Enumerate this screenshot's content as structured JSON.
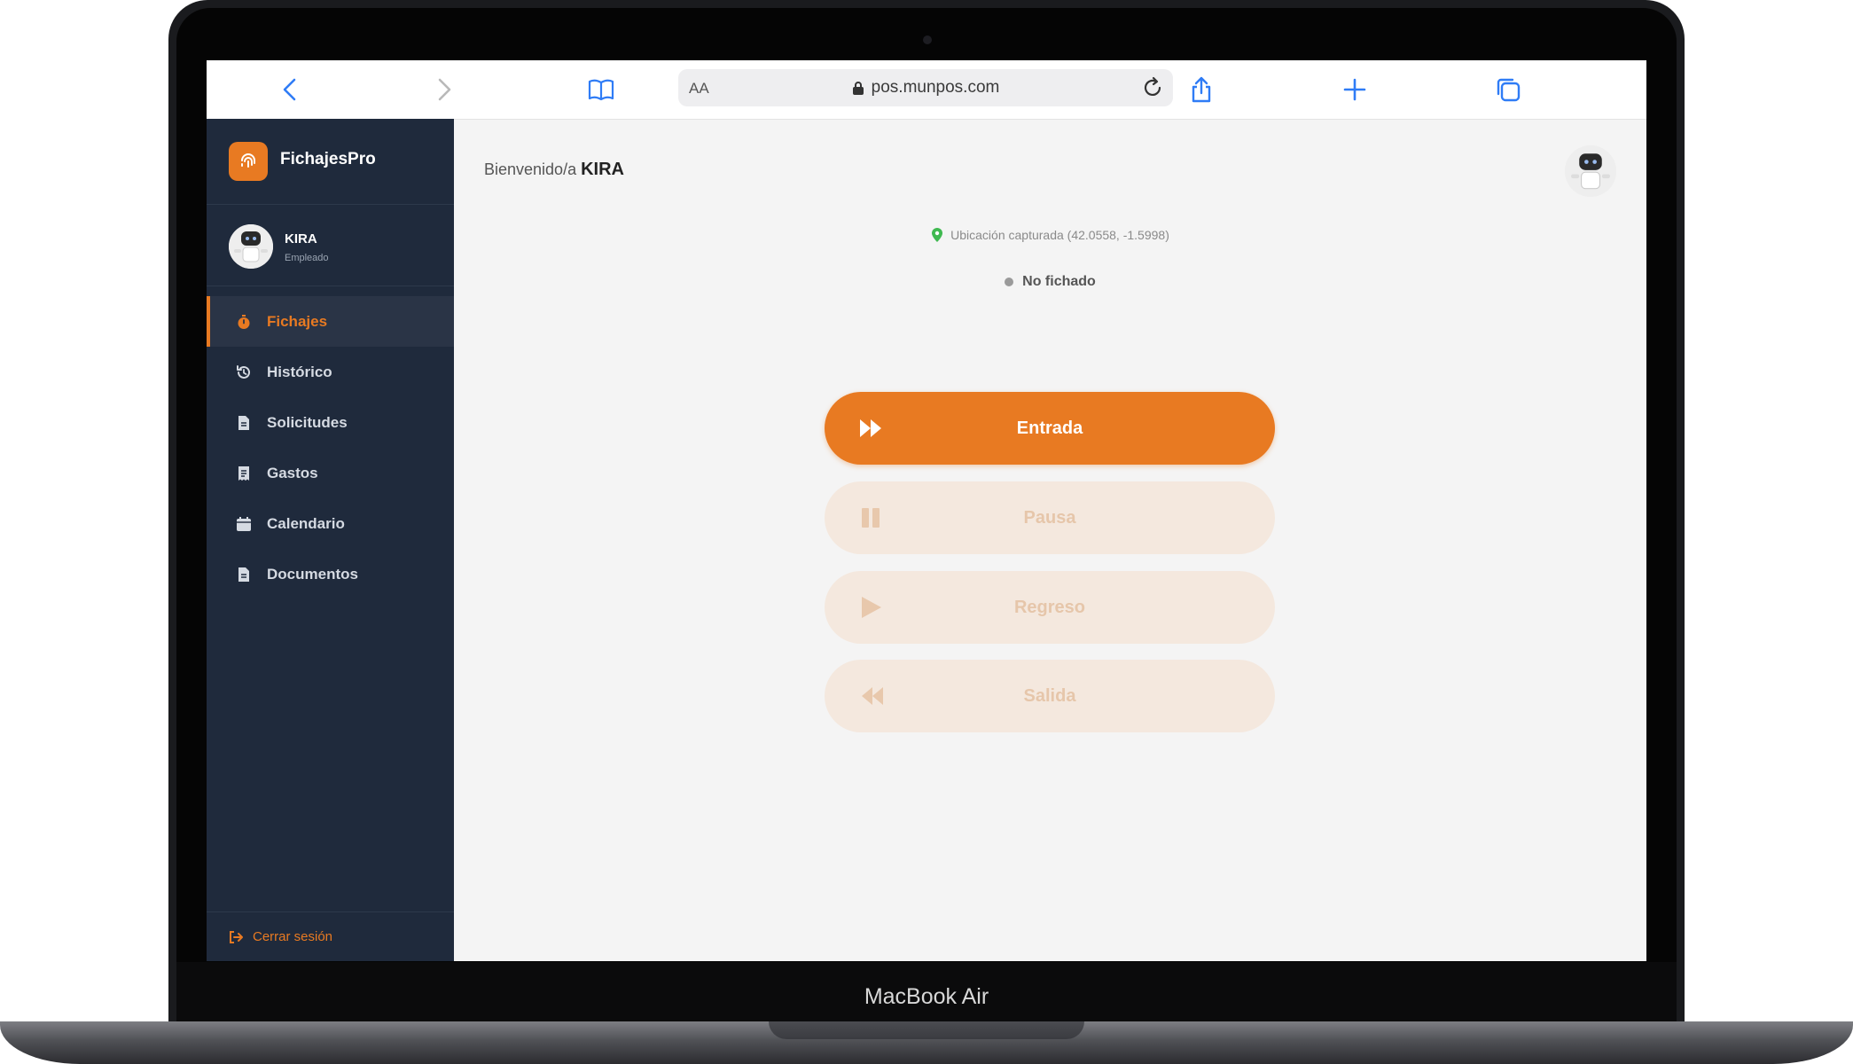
{
  "device": {
    "label": "MacBook Air"
  },
  "browser": {
    "reader_label": "AA",
    "url": "pos.munpos.com",
    "icons": [
      "back-icon",
      "forward-icon",
      "bookmarks-icon",
      "lock-icon",
      "reload-icon",
      "share-icon",
      "new-tab-icon",
      "tabs-icon"
    ]
  },
  "app": {
    "name": "FichajesPro"
  },
  "user": {
    "name": "KIRA",
    "role": "Empleado"
  },
  "sidebar": {
    "items": [
      {
        "label": "Fichajes",
        "icon": "stopwatch-icon",
        "active": true
      },
      {
        "label": "Histórico",
        "icon": "history-icon",
        "active": false
      },
      {
        "label": "Solicitudes",
        "icon": "document-icon",
        "active": false
      },
      {
        "label": "Gastos",
        "icon": "receipt-icon",
        "active": false
      },
      {
        "label": "Calendario",
        "icon": "calendar-icon",
        "active": false
      },
      {
        "label": "Documentos",
        "icon": "file-icon",
        "active": false
      }
    ],
    "logout_label": "Cerrar sesión"
  },
  "main": {
    "welcome_prefix": "Bienvenido/a",
    "welcome_name": "KIRA",
    "location_text": "Ubicación capturada (42.0558, -1.5998)",
    "status_text": "No fichado",
    "buttons": [
      {
        "label": "Entrada",
        "icon": "fast-forward-icon",
        "enabled": true
      },
      {
        "label": "Pausa",
        "icon": "pause-icon",
        "enabled": false
      },
      {
        "label": "Regreso",
        "icon": "play-icon",
        "enabled": false
      },
      {
        "label": "Salida",
        "icon": "rewind-icon",
        "enabled": false
      }
    ]
  },
  "colors": {
    "accent": "#e87a22",
    "sidebar_bg": "#1f2a3c",
    "location_pin": "#3fb950"
  }
}
